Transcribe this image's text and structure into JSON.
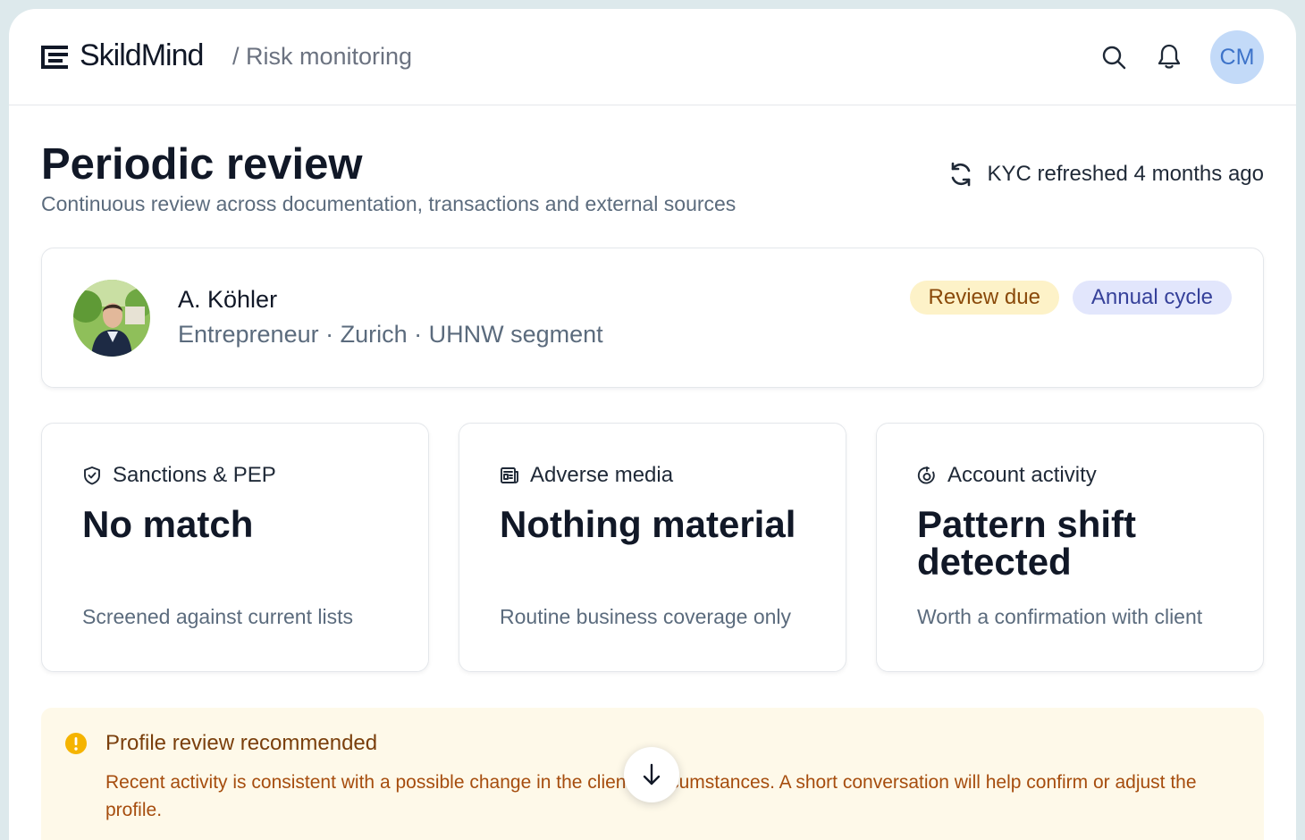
{
  "header": {
    "brand": "SkildMind",
    "breadcrumb": "/ Risk monitoring",
    "avatar_initials": "CM",
    "icons": [
      "logo-icon",
      "search-icon",
      "bell-icon"
    ]
  },
  "page": {
    "title": "Periodic review",
    "subtitle": "Continuous review across documentation, transactions and external sources",
    "kyc_status": "KYC refreshed 4 months ago"
  },
  "client": {
    "name": "A. Köhler",
    "meta": "Entrepreneur · Zurich · UHNW segment",
    "badges": [
      "Review due",
      "Annual cycle"
    ]
  },
  "metrics": [
    {
      "icon": "shield-check-icon",
      "label": "Sanctions & PEP",
      "value": "No match",
      "note": "Screened against current lists"
    },
    {
      "icon": "newspaper-icon",
      "label": "Adverse media",
      "value": "Nothing material",
      "note": "Routine business coverage only"
    },
    {
      "icon": "activity-icon",
      "label": "Account activity",
      "value": "Pattern shift detected",
      "note": "Worth a confirmation with client"
    }
  ],
  "alert": {
    "title": "Profile review recommended",
    "body": "Recent activity is consistent with a possible change in the client’s circumstances. A short conversation will help confirm or adjust the profile."
  },
  "colors": {
    "accent_blue": "#3d73c9",
    "badge_due_bg": "#fdf2c8",
    "badge_cycle_bg": "#e2e6fc",
    "alert_bg": "#fef9e9",
    "alert_icon": "#f5b400"
  }
}
